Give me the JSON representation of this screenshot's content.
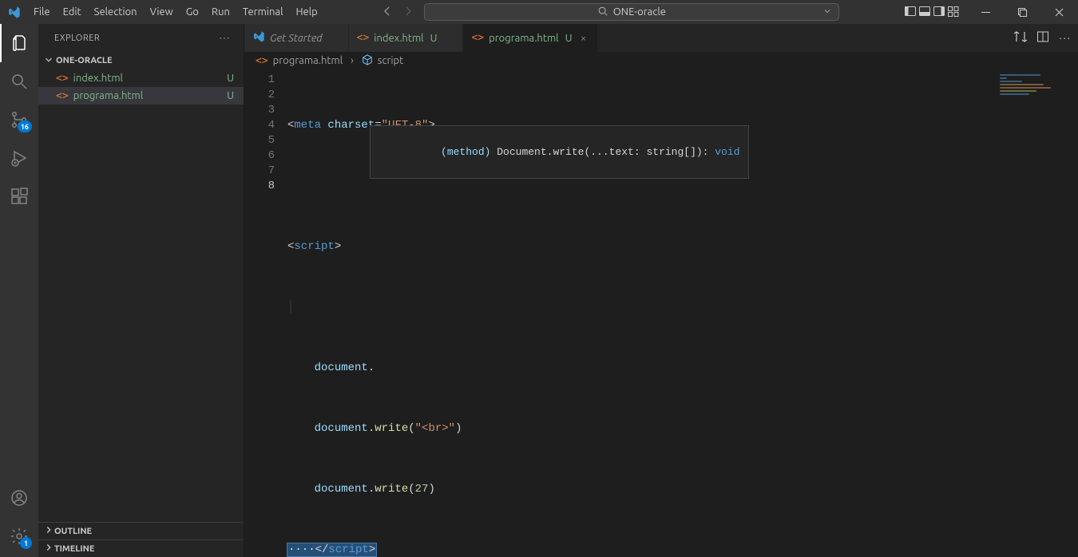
{
  "menubar": [
    "File",
    "Edit",
    "Selection",
    "View",
    "Go",
    "Run",
    "Terminal",
    "Help"
  ],
  "search_placeholder": "ONE-oracle",
  "activitybar": {
    "scm_badge": "16",
    "settings_badge": "1"
  },
  "explorer": {
    "title": "EXPLORER",
    "folder": "ONE-ORACLE",
    "files": [
      {
        "name": "index.html",
        "status": "U",
        "selected": false
      },
      {
        "name": "programa.html",
        "status": "U",
        "selected": true
      }
    ],
    "outline_label": "OUTLINE",
    "timeline_label": "TIMELINE"
  },
  "tabs": [
    {
      "kind": "welcome",
      "label": "Get Started",
      "modified": false,
      "active": false
    },
    {
      "kind": "file",
      "label": "index.html",
      "modified": "U",
      "active": false
    },
    {
      "kind": "file",
      "label": "programa.html",
      "modified": "U",
      "active": true
    }
  ],
  "breadcrumbs": {
    "file": "programa.html",
    "symbol": "script"
  },
  "editor": {
    "lines": [
      1,
      2,
      3,
      4,
      5,
      6,
      7,
      8
    ],
    "active_line": 8,
    "code": {
      "l1": {
        "open": "<",
        "tag": "meta",
        "attr": " charset",
        "eq": "=",
        "str": "\"UFT-8\"",
        "close": ">"
      },
      "l3": {
        "open": "<",
        "tag": "script",
        "close": ">"
      },
      "l5": {
        "indent": "    ",
        "obj": "document",
        "dot": "."
      },
      "l6": {
        "indent": "    ",
        "obj": "document",
        "dot": ".",
        "fn": "write",
        "p1": "(",
        "str": "\"<br>\"",
        "p2": ")"
      },
      "l7": {
        "indent": "    ",
        "obj": "document",
        "dot": ".",
        "fn": "write",
        "p1": "(",
        "num": "27",
        "p2": ")"
      },
      "l8": {
        "ws": "····",
        "open": "</",
        "tag": "script",
        "close": ">"
      }
    },
    "tooltip": {
      "method_kw": "(method)",
      "sig": " Document.write(...text: string[]): ",
      "ret": "void"
    }
  }
}
